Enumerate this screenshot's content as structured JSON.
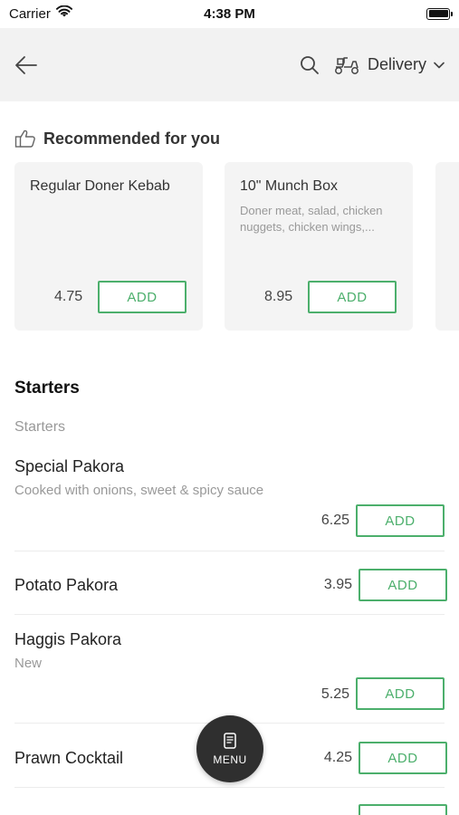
{
  "status_bar": {
    "carrier": "Carrier",
    "time": "4:38 PM"
  },
  "header": {
    "delivery_label": "Delivery"
  },
  "recommended": {
    "title": "Recommended for you",
    "cards": [
      {
        "name": "Regular Doner Kebab",
        "desc": "",
        "price": "4.75",
        "add_label": "ADD"
      },
      {
        "name": "10\" Munch Box",
        "desc": "Doner meat, salad, chicken nuggets, chicken wings,...",
        "price": "8.95",
        "add_label": "ADD"
      }
    ]
  },
  "section": {
    "title": "Starters",
    "subtitle": "Starters"
  },
  "items": [
    {
      "name": "Special Pakora",
      "desc": "Cooked with onions, sweet & spicy sauce",
      "price": "6.25",
      "add_label": "ADD"
    },
    {
      "name": "Potato Pakora",
      "desc": "",
      "price": "3.95",
      "add_label": "ADD"
    },
    {
      "name": "Haggis Pakora",
      "desc": "New",
      "price": "5.25",
      "add_label": "ADD"
    },
    {
      "name": "Prawn Cocktail",
      "desc": "",
      "price": "4.25",
      "add_label": "ADD"
    }
  ],
  "fab": {
    "label": "MENU"
  },
  "colors": {
    "accent": "#4caf6c",
    "header_bg": "#f2f2f2",
    "card_bg": "#f4f4f4",
    "fab_bg": "#2f2f2f"
  }
}
